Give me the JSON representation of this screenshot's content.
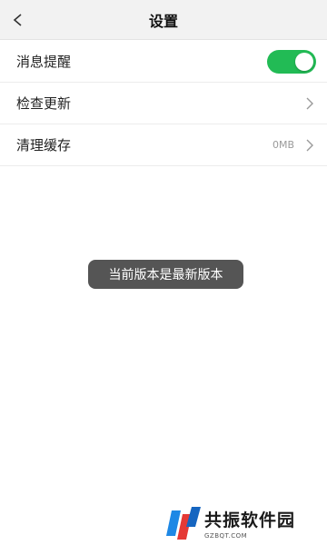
{
  "header": {
    "title": "设置",
    "back_icon": "chevron-left-icon"
  },
  "settings": {
    "notifications": {
      "label": "消息提醒",
      "enabled": true,
      "accent": "#22bb55"
    },
    "check_update": {
      "label": "检查更新"
    },
    "clear_cache": {
      "label": "清理缓存",
      "value": "0MB"
    }
  },
  "toast": {
    "text": "当前版本是最新版本"
  },
  "watermark": {
    "name": "共振软件园",
    "url": "GZBQT.COM"
  }
}
